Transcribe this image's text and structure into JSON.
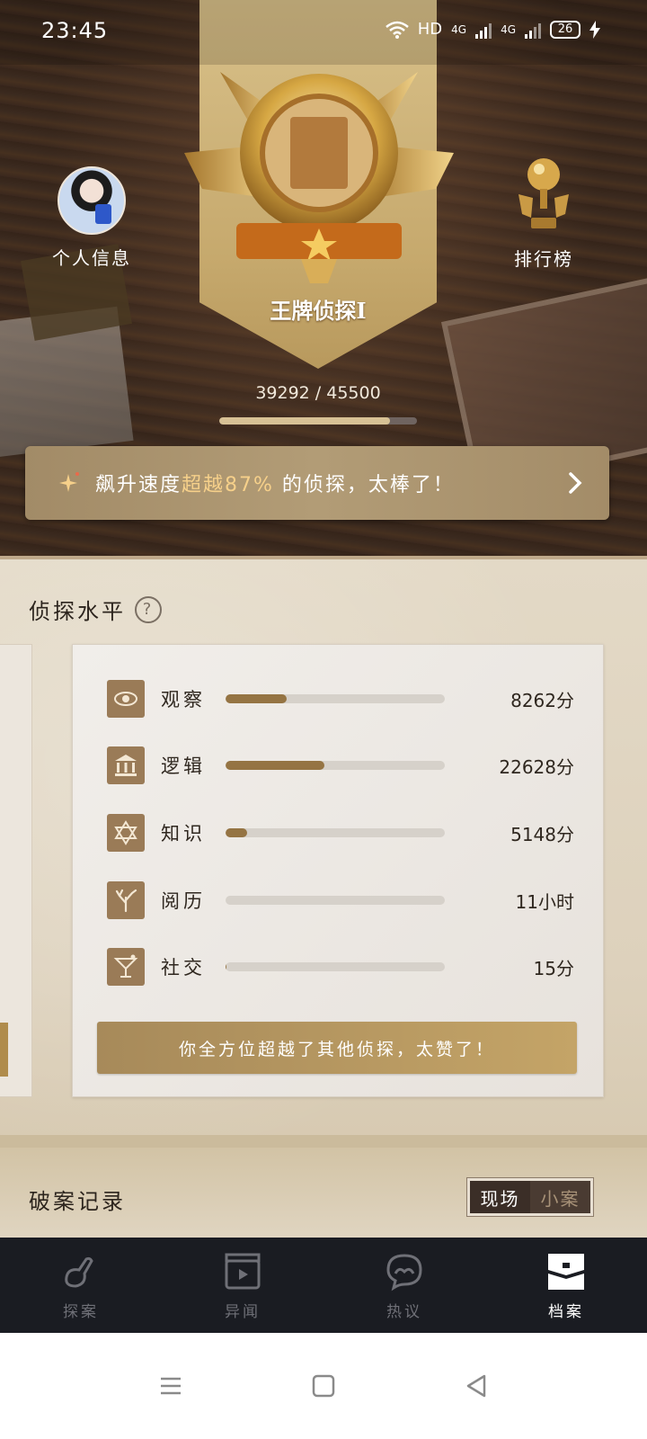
{
  "status_bar": {
    "time": "23:45",
    "network": "HD",
    "sim1": "4G",
    "sim2": "4G",
    "battery": "26"
  },
  "profile": {
    "label": "个人信息"
  },
  "leaderboard": {
    "label": "排行榜"
  },
  "rank": {
    "title": "王牌侦探I",
    "exp_current": 39292,
    "exp_total": 45500,
    "exp_text": "39292 / 45500"
  },
  "speed": {
    "prefix": "飙升速度",
    "highlight": "超越87%",
    "suffix": " 的侦探，太棒了！",
    "highlight_color": "#f6d08a"
  },
  "level": {
    "title": "侦探水平",
    "help": "?",
    "stats": [
      {
        "name": "观察",
        "value": "8262分",
        "progress": 0.28,
        "icon": "eye-icon"
      },
      {
        "name": "逻辑",
        "value": "22628分",
        "progress": 0.45,
        "icon": "temple-icon"
      },
      {
        "name": "知识",
        "value": "5148分",
        "progress": 0.1,
        "icon": "star-of-david-icon"
      },
      {
        "name": "阅历",
        "value": "11小时",
        "progress": 0.0,
        "icon": "branch-icon"
      },
      {
        "name": "社交",
        "value": "15分",
        "progress": 0.005,
        "icon": "cocktail-icon"
      }
    ],
    "summary": "你全方位超越了其他侦探，太赞了！"
  },
  "records": {
    "title": "破案记录",
    "toggle": {
      "scene": "现场",
      "small": "小案"
    }
  },
  "nav": {
    "items": [
      {
        "label": "探案",
        "icon": "magnifier-icon",
        "active": false
      },
      {
        "label": "异闻",
        "icon": "clapperboard-icon",
        "active": false
      },
      {
        "label": "热议",
        "icon": "chat-bubble-icon",
        "active": false
      },
      {
        "label": "档案",
        "icon": "archive-icon",
        "active": true
      }
    ]
  },
  "colors": {
    "accent_gold": "#c6a96d",
    "bar_fill": "#957443",
    "nav_bg": "#1a1c22"
  }
}
